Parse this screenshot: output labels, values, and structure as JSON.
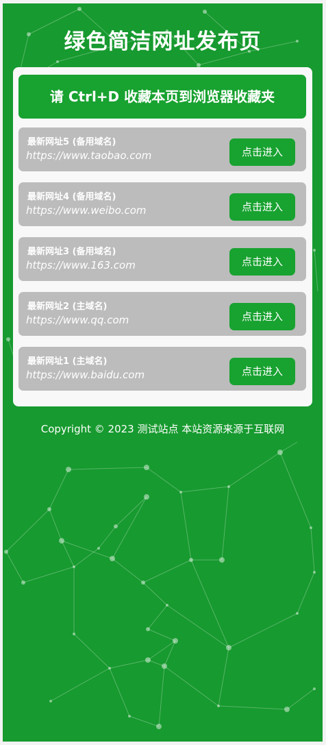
{
  "page": {
    "title": "绿色简洁网址发布页",
    "notice": "请 Ctrl+D 收藏本页到浏览器收藏夹",
    "links": [
      {
        "label": "最新网址5 (备用域名)",
        "url": "https://www.taobao.com",
        "button": "点击进入"
      },
      {
        "label": "最新网址4 (备用域名)",
        "url": "https://www.weibo.com",
        "button": "点击进入"
      },
      {
        "label": "最新网址3 (备用域名)",
        "url": "https://www.163.com",
        "button": "点击进入"
      },
      {
        "label": "最新网址2 (主域名)",
        "url": "https://www.qq.com",
        "button": "点击进入"
      },
      {
        "label": "最新网址1 (主域名)",
        "url": "https://www.baidu.com",
        "button": "点击进入"
      }
    ],
    "footer": "Copyright © 2023 测试站点 本站资源来源于互联网"
  },
  "colors": {
    "background": "#179a2f",
    "accent": "#18a230",
    "row": "#bcbcbc",
    "panel": "#f8f8f8"
  }
}
